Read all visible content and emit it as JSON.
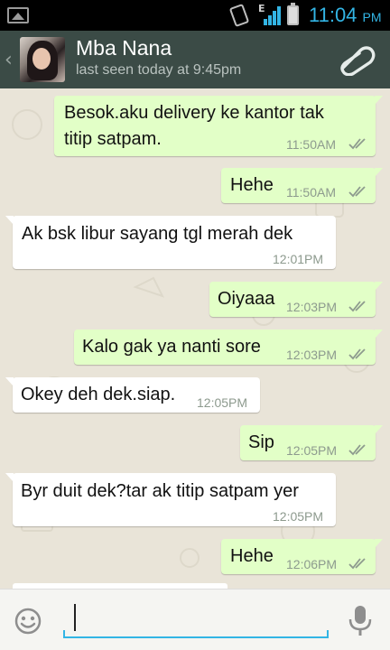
{
  "status_bar": {
    "network": "E",
    "time": "11:04",
    "ampm": "PM",
    "icons": [
      "gallery-icon",
      "vibrate-icon",
      "signal-icon",
      "battery-charging-icon"
    ]
  },
  "header": {
    "back_icon": "back-chevron-icon",
    "contact_name": "Mba Nana",
    "last_seen": "last seen today at 9:45pm",
    "attach_icon": "paperclip-icon"
  },
  "messages": [
    {
      "direction": "out",
      "text": "Besok.aku delivery ke kantor tak\ntitip satpam.",
      "time": "11:50AM",
      "status": "double-check-icon"
    },
    {
      "direction": "out",
      "text": "Hehe",
      "time": "11:50AM",
      "status": "double-check-icon"
    },
    {
      "direction": "in",
      "text": "Ak bsk libur sayang tgl merah dek",
      "time": "12:01PM"
    },
    {
      "direction": "out",
      "text": "Oiyaaa",
      "time": "12:03PM",
      "status": "double-check-icon"
    },
    {
      "direction": "out",
      "text": "Kalo gak ya nanti sore",
      "time": "12:03PM",
      "status": "double-check-icon"
    },
    {
      "direction": "in",
      "text": "Okey deh dek.siap.",
      "time": "12:05PM"
    },
    {
      "direction": "out",
      "text": "Sip",
      "time": "12:05PM",
      "status": "double-check-icon"
    },
    {
      "direction": "in",
      "text": "Byr duit dek?tar ak titip satpam yer",
      "time": "12:05PM"
    },
    {
      "direction": "out",
      "text": "Hehe",
      "time": "12:06PM",
      "status": "double-check-icon"
    }
  ],
  "composer": {
    "value": "",
    "emoji_icon": "emoji-icon",
    "mic_icon": "microphone-icon"
  },
  "colors": {
    "status_accent": "#33b5e5",
    "header_bg": "#3b4b46",
    "outgoing_bubble": "#e2ffc7",
    "incoming_bubble": "#ffffff",
    "tick_color": "#8d9a8e"
  }
}
